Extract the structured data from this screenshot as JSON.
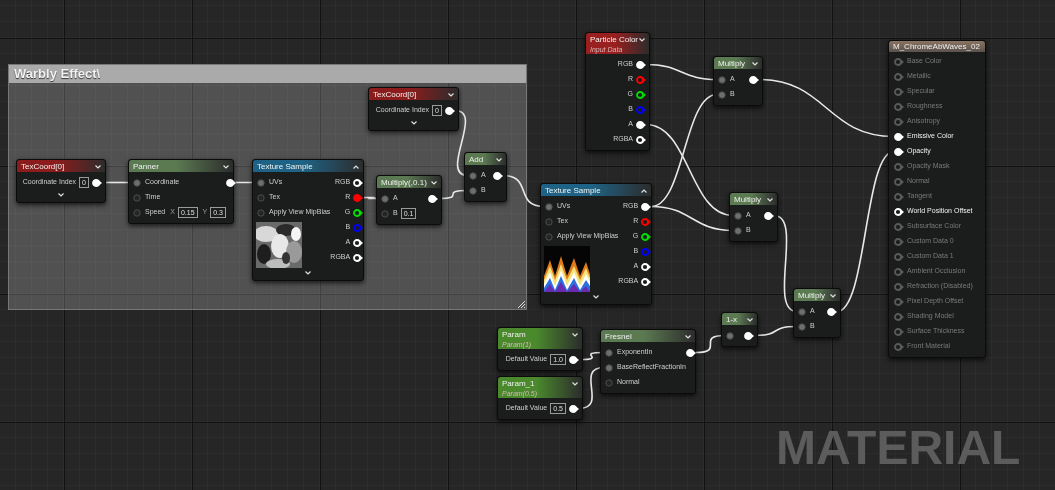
{
  "comment": {
    "title": "Warbly Effect\\"
  },
  "nodes": [
    {
      "title": "TexCoord[0]",
      "color": "#8c1c1c",
      "expanded": false,
      "has_advanced": true,
      "outputs": [
        {
          "label": "Coordinate Index",
          "value": "0",
          "connected": true
        }
      ]
    },
    {
      "title": "Panner",
      "color": "#5b7a52",
      "expanded": false,
      "has_advanced": false,
      "inputs": [
        {
          "label": "Coordinate",
          "connected": true
        },
        {
          "label": "Time",
          "connected": false
        },
        {
          "label": "Speed",
          "connected": false,
          "fields": [
            {
              "axis": "X",
              "value": "0.15"
            },
            {
              "axis": "Y",
              "value": "0.3"
            }
          ]
        }
      ],
      "outputs": [
        {
          "connected": true
        }
      ]
    },
    {
      "title": "Texture Sample",
      "color": "#1e6386",
      "expanded": true,
      "has_advanced": true,
      "inputs": [
        {
          "label": "UVs",
          "connected": true
        },
        {
          "label": "Tex",
          "connected": false
        },
        {
          "label": "Apply View MipBias",
          "connected": false
        }
      ],
      "outputs": [
        {
          "label": "RGB",
          "connected": false,
          "color": "#ffffff"
        },
        {
          "label": "R",
          "connected": true,
          "color": "#ff0000"
        },
        {
          "label": "G",
          "connected": false,
          "color": "#00e000"
        },
        {
          "label": "B",
          "connected": false,
          "color": "#0000ff"
        },
        {
          "label": "A",
          "connected": false,
          "color": "#ffffff"
        },
        {
          "label": "RGBA",
          "connected": false,
          "color": "#ffffff"
        }
      ]
    },
    {
      "title": "TexCoord[0]",
      "color": "#8c1c1c",
      "expanded": false,
      "has_advanced": true,
      "outputs": [
        {
          "label": "Coordinate Index",
          "value": "0",
          "connected": true
        }
      ]
    },
    {
      "title": "Multiply(,0.1)",
      "color": "#5b7a52",
      "expanded": false,
      "has_advanced": false,
      "inputs": [
        {
          "label": "A",
          "connected": true
        },
        {
          "label": "B",
          "connected": false,
          "fields": [
            {
              "value": "0.1"
            }
          ]
        }
      ],
      "outputs": [
        {
          "connected": true
        }
      ]
    },
    {
      "title": "Add",
      "color": "#5b7a52",
      "expanded": false,
      "has_advanced": false,
      "inputs": [
        {
          "label": "A",
          "connected": true
        },
        {
          "label": "B",
          "connected": true
        }
      ],
      "outputs": [
        {
          "connected": true
        }
      ]
    },
    {
      "title": "Particle Color",
      "subtitle": "Input Data",
      "color": "#9a1f1f",
      "expanded": false,
      "has_advanced": false,
      "outputs": [
        {
          "label": "RGB",
          "connected": true,
          "color": "#ffffff"
        },
        {
          "label": "R",
          "connected": false,
          "color": "#ff0000"
        },
        {
          "label": "G",
          "connected": false,
          "color": "#00e000"
        },
        {
          "label": "B",
          "connected": false,
          "color": "#0000ff"
        },
        {
          "label": "A",
          "connected": true,
          "color": "#ffffff"
        },
        {
          "label": "RGBA",
          "connected": false,
          "color": "#ffffff"
        }
      ]
    },
    {
      "title": "Texture Sample",
      "color": "#1e6386",
      "expanded": true,
      "has_advanced": true,
      "inputs": [
        {
          "label": "UVs",
          "connected": true
        },
        {
          "label": "Tex",
          "connected": false
        },
        {
          "label": "Apply View MipBias",
          "connected": false
        }
      ],
      "outputs": [
        {
          "label": "RGB",
          "connected": true,
          "color": "#ffffff"
        },
        {
          "label": "R",
          "connected": false,
          "color": "#ff0000"
        },
        {
          "label": "G",
          "connected": false,
          "color": "#00e000"
        },
        {
          "label": "B",
          "connected": false,
          "color": "#0000ff"
        },
        {
          "label": "A",
          "connected": false,
          "color": "#ffffff"
        },
        {
          "label": "RGBA",
          "connected": false,
          "color": "#ffffff"
        }
      ]
    },
    {
      "title": "Multiply",
      "color": "#5b7a52",
      "expanded": false,
      "has_advanced": false,
      "inputs": [
        {
          "label": "A",
          "connected": true
        },
        {
          "label": "B",
          "connected": true
        }
      ],
      "outputs": [
        {
          "connected": true
        }
      ]
    },
    {
      "title": "Multiply",
      "color": "#5b7a52",
      "expanded": false,
      "has_advanced": false,
      "inputs": [
        {
          "label": "A",
          "connected": true
        },
        {
          "label": "B",
          "connected": true
        }
      ],
      "outputs": [
        {
          "connected": true
        }
      ]
    },
    {
      "title": "Multiply",
      "color": "#5b7a52",
      "expanded": false,
      "has_advanced": false,
      "inputs": [
        {
          "label": "A",
          "connected": true
        },
        {
          "label": "B",
          "connected": true
        }
      ],
      "outputs": [
        {
          "connected": true
        }
      ]
    },
    {
      "title": "1-x",
      "color": "#5b7a52",
      "expanded": false,
      "has_advanced": false,
      "inputs": [
        {
          "connected": true
        }
      ],
      "outputs": [
        {
          "connected": true
        }
      ]
    },
    {
      "title": "Param",
      "subtitle": "Param(1)",
      "color": "#4a8a2c",
      "expanded": false,
      "has_advanced": false,
      "outputs": [
        {
          "label": "Default Value",
          "value": "1.0",
          "connected": true
        }
      ]
    },
    {
      "title": "Param_1",
      "subtitle": "Param(0.5)",
      "color": "#4a8a2c",
      "expanded": false,
      "has_advanced": false,
      "outputs": [
        {
          "label": "Default Value",
          "value": "0.5",
          "connected": true
        }
      ]
    },
    {
      "title": "Fresnel",
      "color": "#5b7a52",
      "expanded": false,
      "has_advanced": false,
      "inputs": [
        {
          "label": "ExponentIn",
          "connected": true
        },
        {
          "label": "BaseReflectFractionIn",
          "connected": true
        },
        {
          "label": "Normal",
          "connected": false
        }
      ],
      "outputs": [
        {
          "connected": true
        }
      ]
    }
  ],
  "result": {
    "title": "M_ChromeAbWaves_02",
    "pins": [
      {
        "label": "Base Color",
        "enabled": false,
        "connected": false
      },
      {
        "label": "Metallic",
        "enabled": false,
        "connected": false
      },
      {
        "label": "Specular",
        "enabled": false,
        "connected": false
      },
      {
        "label": "Roughness",
        "enabled": false,
        "connected": false
      },
      {
        "label": "Anisotropy",
        "enabled": false,
        "connected": false
      },
      {
        "label": "Emissive Color",
        "enabled": true,
        "connected": true
      },
      {
        "label": "Opacity",
        "enabled": true,
        "connected": true
      },
      {
        "label": "Opacity Mask",
        "enabled": false,
        "connected": false
      },
      {
        "label": "Normal",
        "enabled": false,
        "connected": false
      },
      {
        "label": "Tangent",
        "enabled": false,
        "connected": false
      },
      {
        "label": "World Position Offset",
        "enabled": true,
        "connected": false
      },
      {
        "label": "Subsurface Color",
        "enabled": false,
        "connected": false
      },
      {
        "label": "Custom Data 0",
        "enabled": false,
        "connected": false
      },
      {
        "label": "Custom Data 1",
        "enabled": false,
        "connected": false
      },
      {
        "label": "Ambient Occlusion",
        "enabled": false,
        "connected": false
      },
      {
        "label": "Refraction (Disabled)",
        "enabled": false,
        "connected": false
      },
      {
        "label": "Pixel Depth Offset",
        "enabled": false,
        "connected": false
      },
      {
        "label": "Shading Model",
        "enabled": false,
        "connected": false
      },
      {
        "label": "Surface Thickness",
        "enabled": false,
        "connected": false
      },
      {
        "label": "Front Material",
        "enabled": false,
        "connected": false
      }
    ]
  },
  "graph_label": "MATERIAL"
}
